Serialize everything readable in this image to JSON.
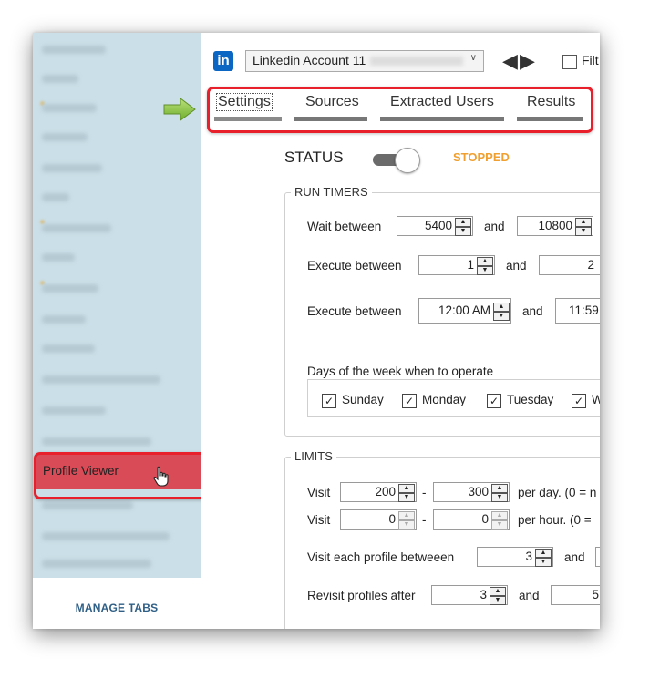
{
  "sidebar": {
    "items": [
      {
        "label": "Profile Viewer",
        "selected": true
      }
    ],
    "manage_tabs_label": "MANAGE TABS"
  },
  "header": {
    "logo_text": "in",
    "account_select": "Linkedin Account 11",
    "filter_label": "Filt"
  },
  "tabs": [
    {
      "label": "Settings",
      "active": true
    },
    {
      "label": "Sources"
    },
    {
      "label": "Extracted Users"
    },
    {
      "label": "Results"
    }
  ],
  "status": {
    "label": "STATUS",
    "value": "STOPPED",
    "value_color": "#f0a030"
  },
  "run_timers": {
    "legend": "RUN TIMERS",
    "wait_label": "Wait between",
    "wait_min": "5400",
    "wait_and": "and",
    "wait_max": "10800",
    "execute1_label": "Execute between",
    "execute1_min": "1",
    "execute1_and": "and",
    "execute1_max": "2",
    "execute2_label": "Execute between",
    "execute2_min": "12:00 AM",
    "execute2_and": "and",
    "execute2_max": "11:59",
    "days_label": "Days of the week when to operate",
    "days": [
      {
        "label": "Sunday",
        "checked": true
      },
      {
        "label": "Monday",
        "checked": true
      },
      {
        "label": "Tuesday",
        "checked": true
      },
      {
        "label": "W",
        "checked": true
      }
    ]
  },
  "limits": {
    "legend": "LIMITS",
    "visit_day_label": "Visit",
    "visit_day_min": "200",
    "visit_day_dash": "-",
    "visit_day_max": "300",
    "visit_day_suffix": "per day. (0 = n",
    "visit_hour_label": "Visit",
    "visit_hour_min": "0",
    "visit_hour_dash": "-",
    "visit_hour_max": "0",
    "visit_hour_suffix": "per hour. (0 =",
    "each_profile_label": "Visit each profile betweeen",
    "each_profile_min": "3",
    "each_profile_and": "and",
    "revisit_label": "Revisit profiles after",
    "revisit_min": "3",
    "revisit_and": "and",
    "revisit_max": "5"
  },
  "colors": {
    "highlight_red": "#e8202b",
    "sidebar_bg": "#cbdfe8",
    "selected_item_bg": "#d94b57",
    "pointer_arrow": "#8dc63f"
  }
}
